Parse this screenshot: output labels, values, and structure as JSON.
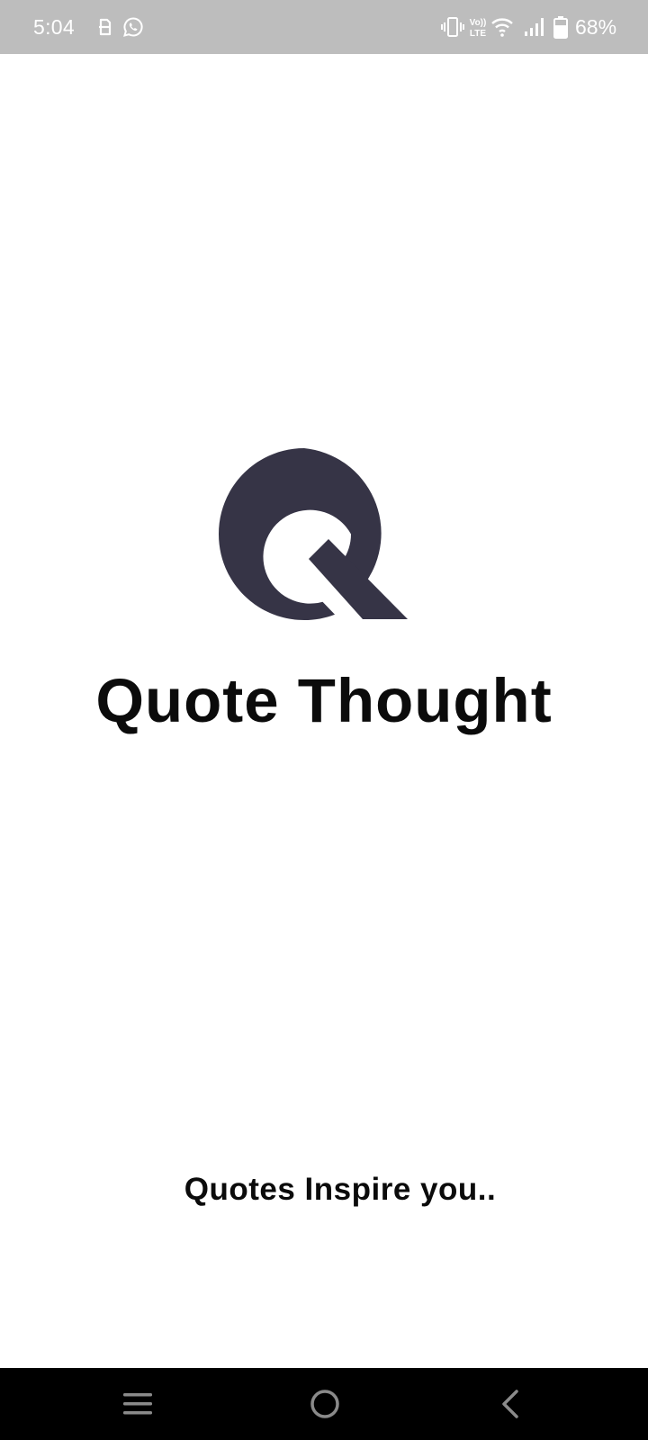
{
  "status_bar": {
    "time": "5:04",
    "battery_percent": "68%",
    "left_icons": [
      "sim-toolkit-icon",
      "whatsapp-icon"
    ],
    "right_icons": [
      "vibrate-icon",
      "volte-icon",
      "wifi-icon",
      "signal-icon",
      "battery-icon"
    ],
    "volte_top": "Vo))",
    "volte_bottom": "LTE",
    "battery_level": 0.68
  },
  "splash": {
    "logo_icon": "q-logo-icon",
    "logo_color": "#363446",
    "title": "Quote Thought",
    "tagline": "Quotes Inspire you.."
  },
  "nav_bar": {
    "buttons": [
      "menu-icon",
      "home-icon",
      "back-icon"
    ]
  }
}
